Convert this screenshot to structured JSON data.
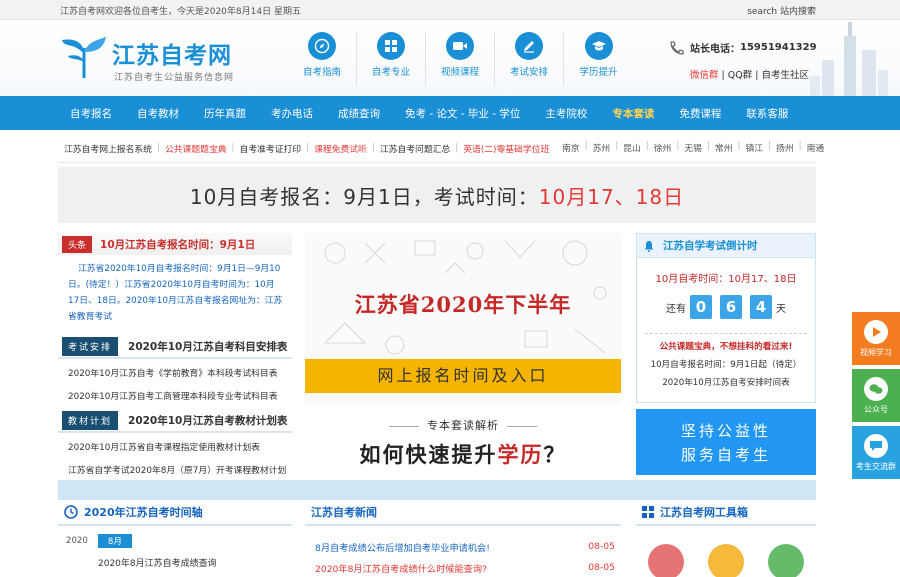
{
  "topbar": {
    "welcome": "江苏自考网欢迎各位自考生，今天是2020年8月14日 星期五",
    "search": "search 站内搜索"
  },
  "logo": {
    "title": "江苏自考网",
    "subtitle": "江苏自考生公益服务信息网"
  },
  "nav_icons": [
    {
      "label": "自考指南",
      "icon": "compass-icon"
    },
    {
      "label": "自考专业",
      "icon": "grid-icon"
    },
    {
      "label": "视频课程",
      "icon": "video-icon"
    },
    {
      "label": "考试安排",
      "icon": "pencil-icon"
    },
    {
      "label": "学历提升",
      "icon": "graduation-cap-icon"
    }
  ],
  "contact": {
    "phone_label": "站长电话：",
    "phone": "15951941329",
    "weibo": "微信群",
    "qq": "QQ群",
    "community": "自考生社区"
  },
  "main_nav": [
    "自考报名",
    "自考教材",
    "历年真题",
    "考办电话",
    "成绩查询",
    "免考 - 论文 - 毕业 - 学位",
    "主考院校",
    "专本套读",
    "免费课程",
    "联系客服"
  ],
  "main_nav_highlight": "专本套读",
  "sub_links": [
    {
      "text": "江苏自考网上报名系统",
      "style": "bold"
    },
    {
      "text": "公共课题题宝典",
      "style": "red"
    },
    {
      "text": "自考准考证打印",
      "style": "normal"
    },
    {
      "text": "课程免费试听",
      "style": "red"
    },
    {
      "text": "江苏自考问题汇总",
      "style": "normal"
    },
    {
      "text": "英语(二)零基础学位班",
      "style": "red"
    }
  ],
  "cities": [
    "南京",
    "苏州",
    "昆山",
    "徐州",
    "无锡",
    "常州",
    "镇江",
    "扬州",
    "南通"
  ],
  "banner": {
    "text": "10月自考报名：9月1日，考试时间：",
    "highlight": "10月17、18日"
  },
  "headline": {
    "tag": "头条",
    "title": "10月江苏自考报名时间：9月1日",
    "lead": "江苏省2020年10月自考报名时间：9月1日—9月10日。(待定！）江苏省2020年10月自考时间为：10月17日、18日。2020年10月江苏自考报名网址为：江苏省教育考试"
  },
  "exam_section": {
    "tag": "考试安排",
    "title": "2020年10月江苏自考科目安排表",
    "items": [
      "2020年10月江苏自考《学前教育》本科段考试科目表",
      "2020年10月江苏自考工商管理本科段专业考试科目表"
    ]
  },
  "book_section": {
    "tag": "教材计划",
    "title": "2020年10月江苏自考教材计划表",
    "items": [
      "2020年10月江苏省自考课程指定使用教材计划表",
      "江苏省自学考试2020年8月（原7月）开考课程教材计划"
    ]
  },
  "promo": {
    "title": "江苏省2020年下半年",
    "strip": "网上报名时间及入口",
    "sub": "专本套读解析",
    "big_prefix": "如何快速提升",
    "big_highlight": "学历",
    "big_suffix": "？"
  },
  "countdown": {
    "title": "江苏自学考试倒计时",
    "date": "10月自考时间：10月17、18日",
    "prefix": "还有",
    "digits": [
      "0",
      "6",
      "4"
    ],
    "suffix": "天",
    "promo": "公共课题宝典，不想挂科的看过来!",
    "items": [
      "10月自考报名时间：9月1日起（待定）",
      "2020年10月江苏自考安排时间表"
    ]
  },
  "slogan": {
    "line1": "坚持公益性",
    "line2": "服务自考生"
  },
  "floaters": [
    {
      "label": "视频学习",
      "icon": "play-icon",
      "color": "#f47c20"
    },
    {
      "label": "公众号",
      "icon": "wechat-icon",
      "color": "#4caf50"
    },
    {
      "label": "考生交流群",
      "icon": "chat-icon",
      "color": "#29a3e0"
    }
  ],
  "timeline": {
    "title": "2020年江苏自考时间轴",
    "year": "2020",
    "month": "8月",
    "item": "2020年8月江苏自考成绩查询"
  },
  "news": {
    "title": "江苏自考新闻",
    "items": [
      {
        "text": "8月自考成绩公布后增加自考毕业申请机会!",
        "date": "08-05",
        "red": false
      },
      {
        "text": "2020年8月江苏自考成绩什么时候能查询?",
        "date": "08-05",
        "red": true
      }
    ]
  },
  "toolbox": {
    "title": "江苏自考网工具箱",
    "tools": [
      {
        "icon": "toolbox-red-icon",
        "color": "#e57373"
      },
      {
        "icon": "toolbox-yellow-icon",
        "color": "#f6b93b"
      },
      {
        "icon": "toolbox-green-icon",
        "color": "#66bb6a"
      }
    ]
  }
}
